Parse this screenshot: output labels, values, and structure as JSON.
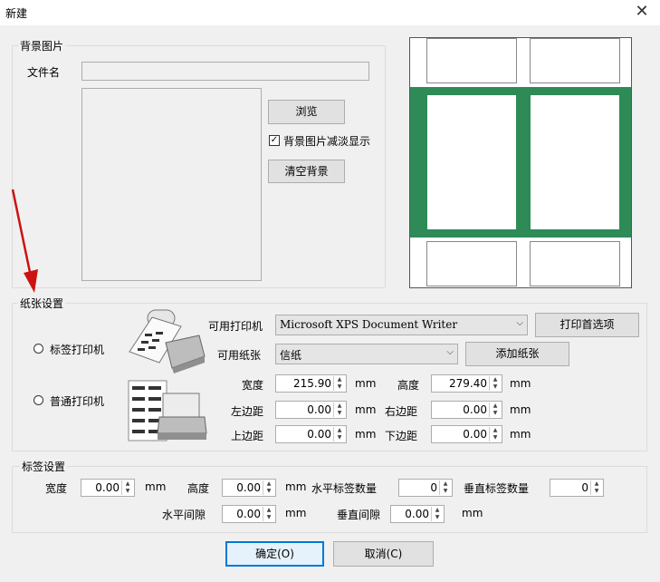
{
  "window": {
    "title": "新建",
    "close_glyph": "✕"
  },
  "bg_group": {
    "legend": "背景图片",
    "filename_label": "文件名",
    "filename_value": "",
    "browse_label": "浏览",
    "fade_label": "背景图片减淡显示",
    "fade_checked": true,
    "clear_label": "清空背景"
  },
  "paper_group": {
    "legend": "纸张设置",
    "label_printer": "标签打印机",
    "normal_printer": "普通打印机",
    "printer_label": "可用打印机",
    "printer_value": "Microsoft XPS Document Writer",
    "print_pref_label": "打印首选项",
    "paper_label": "可用纸张",
    "paper_value": "信纸",
    "add_paper_label": "添加纸张",
    "width_label": "宽度",
    "width_value": "215.90",
    "height_label": "高度",
    "height_value": "279.40",
    "left_label": "左边距",
    "left_value": "0.00",
    "right_label": "右边距",
    "right_value": "0.00",
    "top_label": "上边距",
    "top_value": "0.00",
    "bottom_label": "下边距",
    "bottom_value": "0.00",
    "unit": "mm"
  },
  "label_group": {
    "legend": "标签设置",
    "width_label": "宽度",
    "width_value": "0.00",
    "height_label": "高度",
    "height_value": "0.00",
    "hcount_label": "水平标签数量",
    "hcount_value": "0",
    "vcount_label": "垂直标签数量",
    "vcount_value": "0",
    "hgap_label": "水平间隙",
    "hgap_value": "0.00",
    "vgap_label": "垂直间隙",
    "vgap_value": "0.00",
    "unit": "mm"
  },
  "buttons": {
    "ok": "确定(O)",
    "cancel": "取消(C)"
  },
  "colors": {
    "preview_green": "#2e8b57",
    "arrow": "#cc1111",
    "focus_blue": "#0078d7"
  }
}
